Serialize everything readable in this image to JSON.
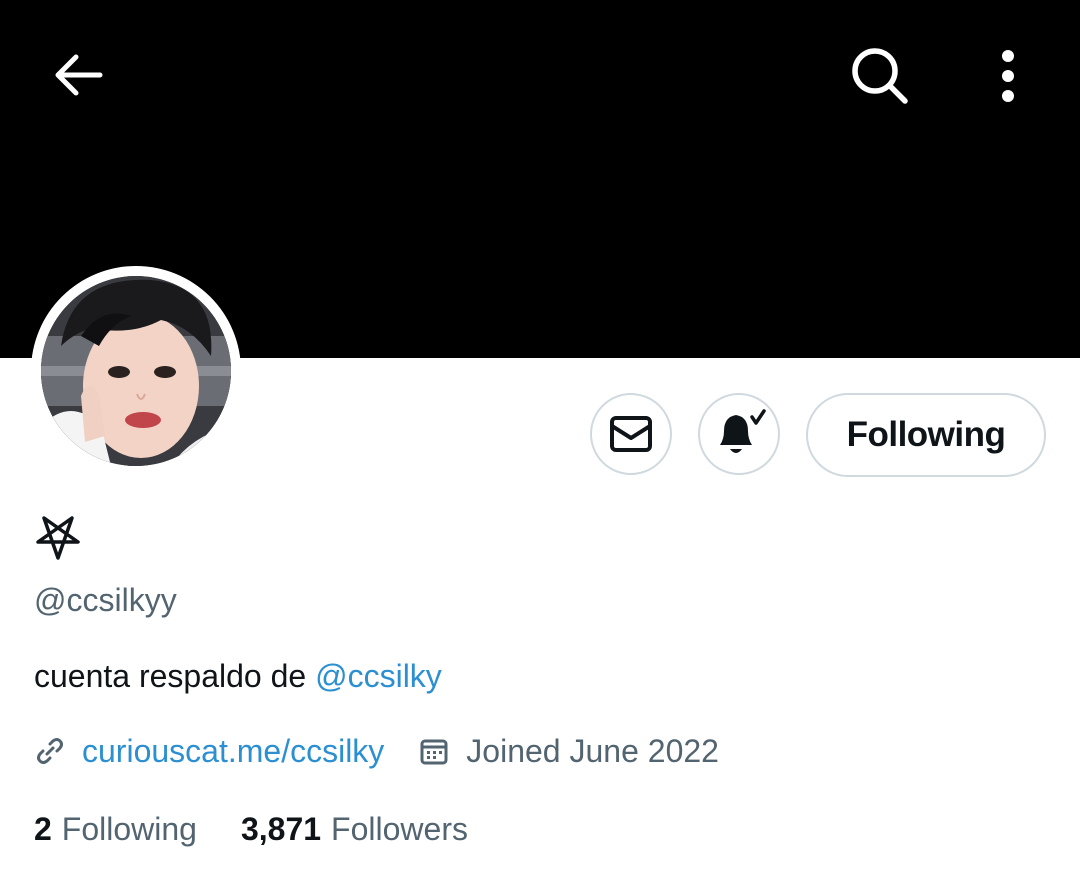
{
  "header": {
    "back_icon": "arrow-left-icon",
    "search_icon": "search-icon",
    "more_icon": "more-vertical-icon",
    "banner_color": "#000000"
  },
  "profile": {
    "display_name_icon": "inverted-pentagram-icon",
    "handle": "@ccsilkyy",
    "bio_text": "cuenta respaldo de ",
    "bio_mention": "@ccsilky",
    "website": "curiouscat.me/ccsilky",
    "joined": "Joined June 2022"
  },
  "actions": {
    "message_icon": "mail-icon",
    "notify_icon": "bell-check-icon",
    "follow_label": "Following"
  },
  "stats": {
    "following_count": "2",
    "following_label": "Following",
    "followers_count": "3,871",
    "followers_label": "Followers"
  },
  "colors": {
    "link": "#2b8fd1",
    "secondary_text": "#536471",
    "border": "#cfd9de"
  }
}
